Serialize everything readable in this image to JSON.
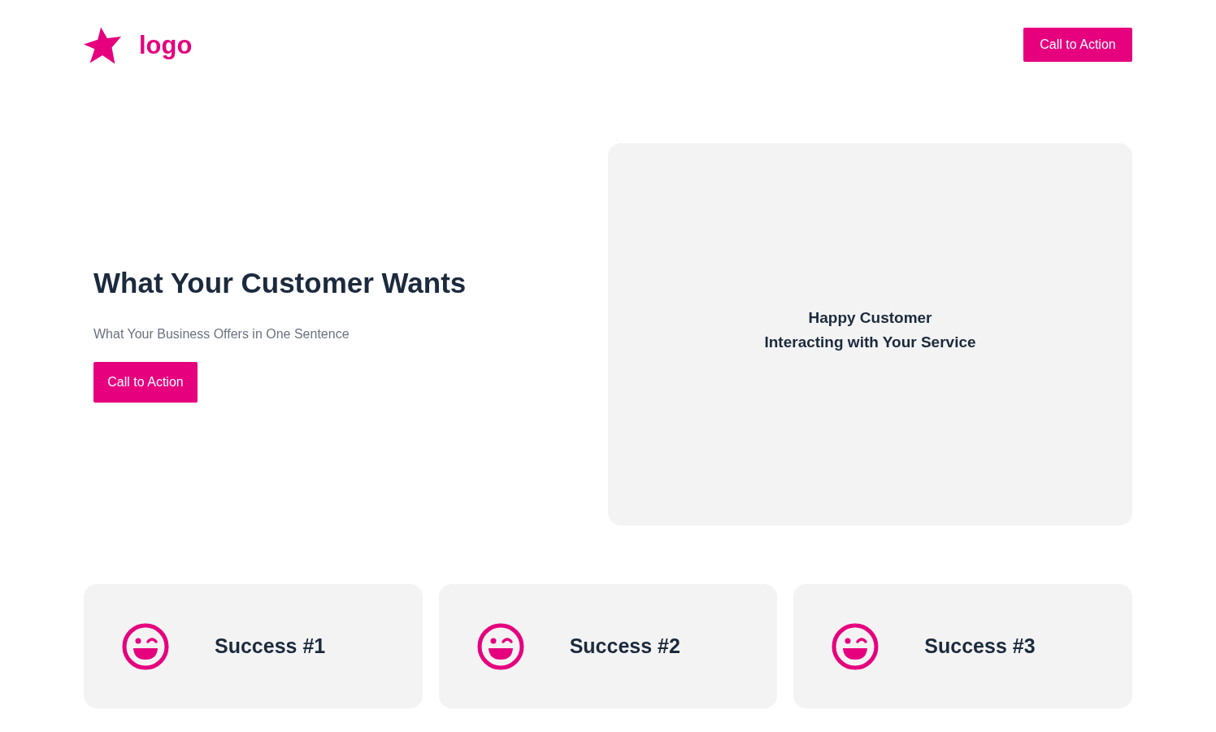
{
  "header": {
    "logo": "logo",
    "button": "Call to Action"
  },
  "hero": {
    "title": "What Your Customer Wants",
    "subtitle": "What Your Business Offers in One Sentence",
    "button": "Call to Action",
    "image_placeholder": [
      "Happy Customer",
      "Interacting with Your Service"
    ]
  },
  "successes": [
    {
      "label": "Success #1"
    },
    {
      "label": "Success #2"
    },
    {
      "label": "Success #3"
    }
  ]
}
